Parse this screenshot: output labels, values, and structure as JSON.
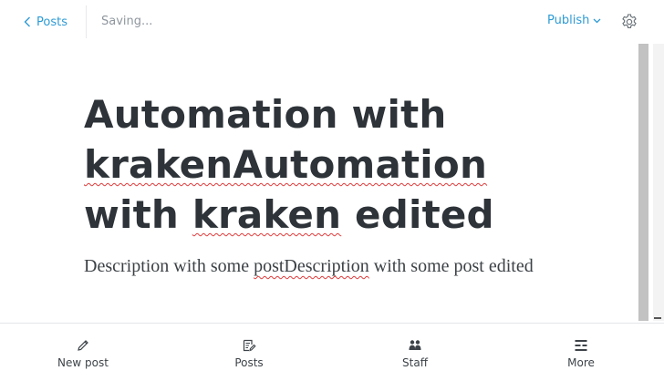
{
  "header": {
    "back_label": "Posts",
    "status": "Saving...",
    "publish_label": "Publish"
  },
  "editor": {
    "title_line1": "Automation with",
    "title_word2": "krakenAutomation",
    "title_word3": "with",
    "title_word4": "kraken",
    "title_word5": "edited",
    "excerpt_before": "Description with some ",
    "excerpt_misspelled": "postDescription",
    "excerpt_after": " with some post edited"
  },
  "tabbar": {
    "items": [
      {
        "label": "New post",
        "icon": "pencil-icon"
      },
      {
        "label": "Posts",
        "icon": "posts-icon"
      },
      {
        "label": "Staff",
        "icon": "staff-icon"
      },
      {
        "label": "More",
        "icon": "more-icon"
      }
    ]
  },
  "colors": {
    "accent": "#2e9bd6",
    "text_dark": "#2d3338",
    "muted": "#8e979e",
    "spellcheck": "#e03b3b"
  }
}
